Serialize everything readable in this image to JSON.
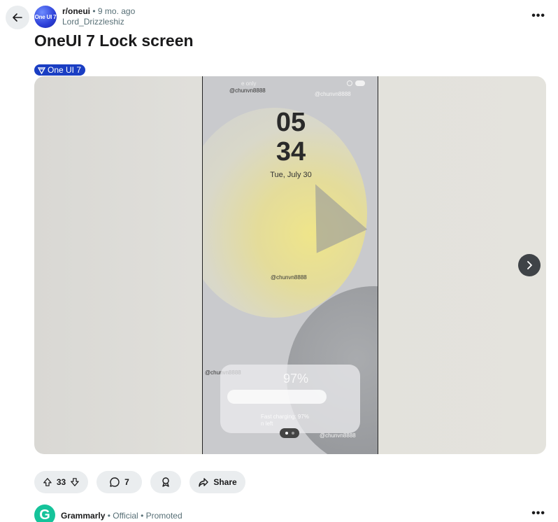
{
  "post": {
    "subreddit": "r/oneui",
    "separator": "•",
    "age": "9 mo. ago",
    "author": "Lord_Drizzleshiz",
    "avatar_text": "One UI 7",
    "title": "OneUI 7 Lock screen",
    "flair": "One UI 7",
    "more": "•••"
  },
  "image": {
    "hour": "05",
    "minute": "34",
    "date": "Tue, July 30",
    "watermark": "@chunvn8888",
    "status_faded": "e only",
    "battery_pct": "97%",
    "charging_text": "Fast charging: 97%",
    "time_left": "n left"
  },
  "actions": {
    "upvotes": "33",
    "comments": "7",
    "share_label": "Share"
  },
  "ad": {
    "logo": "G",
    "name": "Grammarly",
    "separator": "•",
    "official": "Official",
    "promoted": "Promoted",
    "more": "•••"
  },
  "icons": [
    "back-arrow-icon",
    "more-icon",
    "flair-icon",
    "next-arrow-icon",
    "upvote-icon",
    "downvote-icon",
    "comment-icon",
    "award-icon",
    "share-icon"
  ]
}
